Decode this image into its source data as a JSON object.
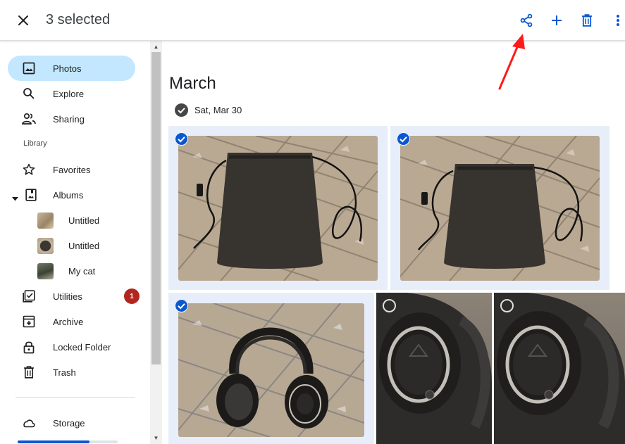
{
  "header": {
    "selection_label": "3 selected",
    "actions": [
      {
        "name": "share",
        "icon": "share-icon"
      },
      {
        "name": "add",
        "icon": "plus-icon"
      },
      {
        "name": "delete",
        "icon": "trash-icon"
      },
      {
        "name": "more",
        "icon": "more-vert-icon"
      }
    ]
  },
  "sidebar": {
    "items": [
      {
        "label": "Photos",
        "icon": "photo-icon",
        "active": true
      },
      {
        "label": "Explore",
        "icon": "search-icon"
      },
      {
        "label": "Sharing",
        "icon": "people-icon"
      }
    ],
    "library_label": "Library",
    "library_items": [
      {
        "label": "Favorites",
        "icon": "star-icon"
      },
      {
        "label": "Albums",
        "icon": "album-icon",
        "expanded": true
      },
      {
        "label": "Untitled",
        "icon": "album-thumbnail"
      },
      {
        "label": "Untitled",
        "icon": "album-thumbnail"
      },
      {
        "label": "My cat",
        "icon": "album-thumbnail"
      },
      {
        "label": "Utilities",
        "icon": "checklist-icon",
        "badge": "1"
      },
      {
        "label": "Archive",
        "icon": "archive-icon"
      },
      {
        "label": "Locked Folder",
        "icon": "lock-icon"
      },
      {
        "label": "Trash",
        "icon": "trash-icon"
      }
    ],
    "storage": {
      "label": "Storage",
      "icon": "cloud-icon",
      "used_fraction": 0.72
    }
  },
  "main": {
    "month": "March",
    "date_group": "Sat, Mar 30",
    "photos": [
      {
        "subject": "headphone pouch with cable",
        "selected": true
      },
      {
        "subject": "headphone pouch with cable",
        "selected": true
      },
      {
        "subject": "over-ear headphones",
        "selected": true
      },
      {
        "subject": "headphone earcup close-up",
        "selected": false
      },
      {
        "subject": "headphone earcup close-up",
        "selected": false
      }
    ]
  },
  "colors": {
    "accent": "#0b57d0",
    "active_nav": "#c2e7ff",
    "selected_tile": "#e8eef9",
    "badge": "#b3261e",
    "annotation": "#ff1a1a"
  }
}
